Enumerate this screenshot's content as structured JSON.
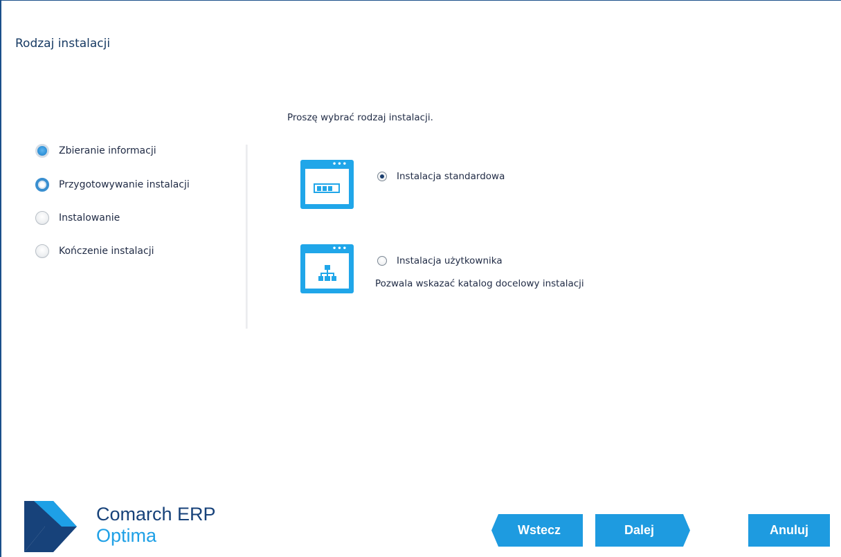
{
  "header": {
    "title": "Rodzaj instalacji"
  },
  "instruction": "Proszę wybrać rodzaj instalacji.",
  "steps": [
    {
      "label": "Zbieranie informacji",
      "state": "done"
    },
    {
      "label": "Przygotowywanie instalacji",
      "state": "current"
    },
    {
      "label": "Instalowanie",
      "state": "todo"
    },
    {
      "label": "Kończenie instalacji",
      "state": "todo"
    }
  ],
  "options": [
    {
      "label": "Instalacja standardowa",
      "selected": true,
      "icon": "progress-window-icon"
    },
    {
      "label": "Instalacja użytkownika",
      "selected": false,
      "icon": "hierarchy-window-icon",
      "description": "Pozwala wskazać katalog docelowy instalacji"
    }
  ],
  "logo": {
    "line1": "Comarch ERP",
    "line2": "Optima"
  },
  "buttons": {
    "back": "Wstecz",
    "next": "Dalej",
    "cancel": "Anuluj"
  },
  "colors": {
    "accent": "#20a6e9",
    "button": "#1e9be0",
    "title": "#173a63",
    "border": "#1a4f8a",
    "logo_dark": "#17427a",
    "logo_light": "#1ea0e6"
  }
}
